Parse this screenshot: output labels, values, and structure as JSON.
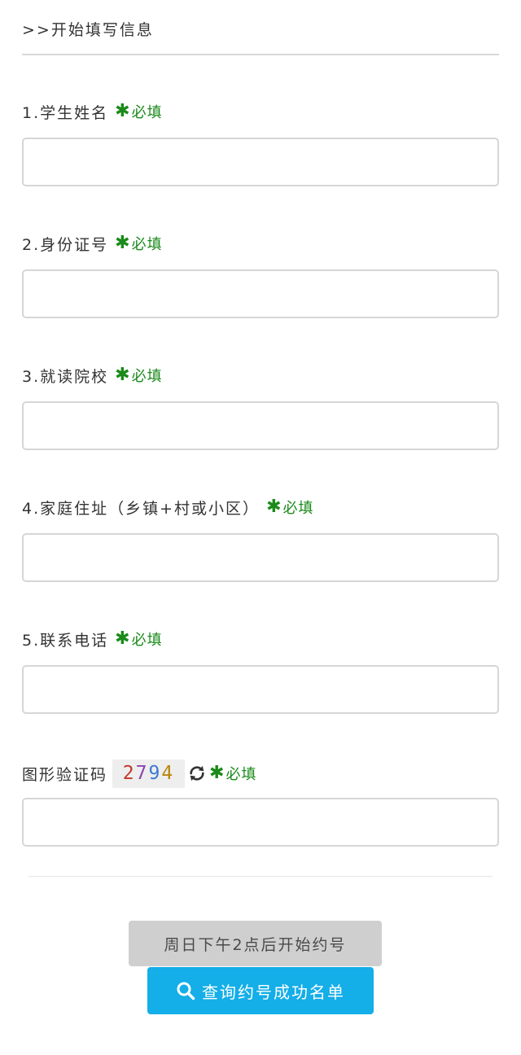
{
  "section": {
    "title": ">>开始填写信息"
  },
  "required_text": "必填",
  "required_star": "✱",
  "fields": [
    {
      "label": "1.学生姓名",
      "value": "",
      "placeholder": ""
    },
    {
      "label": "2.身份证号",
      "value": "",
      "placeholder": ""
    },
    {
      "label": "3.就读院校",
      "value": "",
      "placeholder": ""
    },
    {
      "label": "4.家庭住址（乡镇+村或小区）",
      "value": "",
      "placeholder": ""
    },
    {
      "label": "5.联系电话",
      "value": "",
      "placeholder": ""
    }
  ],
  "captcha": {
    "label": "图形验证码",
    "digits": [
      "2",
      "7",
      "9",
      "4"
    ],
    "refresh_icon": "refresh-icon",
    "value": "",
    "placeholder": ""
  },
  "buttons": {
    "disabled_label": "周日下午2点后开始约号",
    "query_label": "查询约号成功名单",
    "query_icon": "search-icon"
  },
  "colors": {
    "required_green": "#1a8a1a",
    "query_button_blue": "#14aee8",
    "disabled_button_gray": "#cfcfcf"
  }
}
